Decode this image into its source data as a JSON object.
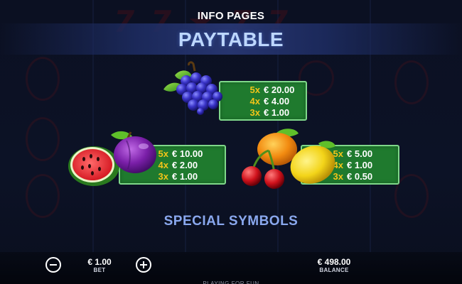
{
  "header": {
    "section_title": "INFO PAGES",
    "page_title": "PAYTABLE"
  },
  "paytable": [
    {
      "symbol": "grapes",
      "icon": "grapes-icon",
      "payouts": [
        {
          "mult": "5x",
          "value": "€ 20.00"
        },
        {
          "mult": "4x",
          "value": "€ 4.00"
        },
        {
          "mult": "3x",
          "value": "€ 1.00"
        }
      ]
    },
    {
      "symbol": "watermelon-plum",
      "icon": "plum-icon",
      "payouts": [
        {
          "mult": "5x",
          "value": "€ 10.00"
        },
        {
          "mult": "4x",
          "value": "€ 2.00"
        },
        {
          "mult": "3x",
          "value": "€ 1.00"
        }
      ]
    },
    {
      "symbol": "cherries-orange-lemon",
      "icon": "lemon-icon",
      "payouts": [
        {
          "mult": "5x",
          "value": "€ 5.00"
        },
        {
          "mult": "4x",
          "value": "€ 1.00"
        },
        {
          "mult": "3x",
          "value": "€ 0.50"
        }
      ]
    }
  ],
  "special_symbols_title": "SPECIAL SYMBOLS",
  "controls": {
    "bet_value": "€ 1.00",
    "bet_label": "BET",
    "balance_value": "€ 498.00",
    "balance_label": "BALANCE",
    "footer_text": "PLAYING FOR FUN"
  },
  "colors": {
    "paybox_bg": "#1f7a2e",
    "paybox_border": "#7fd88a",
    "multiplier": "#f2c419",
    "title": "#bdd7ff",
    "special_title": "#8aa8ee"
  }
}
